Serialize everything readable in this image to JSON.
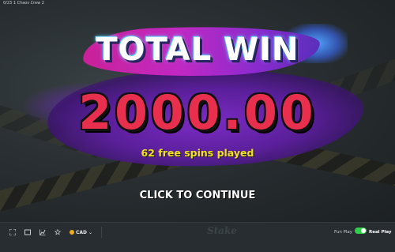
{
  "window": {
    "title": "0/23 1 Chaos Crew 2"
  },
  "win_screen": {
    "heading": "TOTAL WIN",
    "amount": "2000.00",
    "free_spins_text": "62 free spins played",
    "continue_label": "CLICK TO CONTINUE"
  },
  "toolbar": {
    "icons": [
      "fullscreen-icon",
      "window-icon",
      "stats-icon",
      "star-icon"
    ],
    "currency": "CAD",
    "logo": "Stake",
    "fun_play_label": "Fun Play",
    "real_play_label": "Real Play",
    "real_play_enabled": true
  },
  "colors": {
    "amount": "#e8304e",
    "spins_text": "#f5e11c",
    "toggle_on": "#2fcf49",
    "toolbar_bg": "#272d30"
  }
}
